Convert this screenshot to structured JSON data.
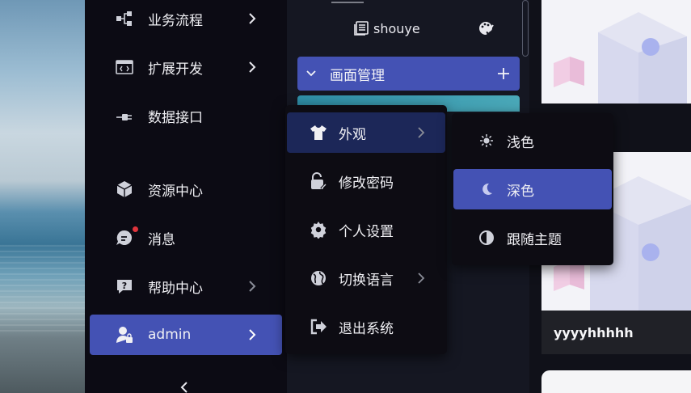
{
  "sidebar": {
    "items": [
      {
        "label": "业务流程",
        "icon": "flow-icon"
      },
      {
        "label": "扩展开发",
        "icon": "code-window-icon"
      },
      {
        "label": "数据接口",
        "icon": "plug-icon"
      },
      {
        "label": "资源中心",
        "icon": "cube-icon"
      },
      {
        "label": "消息",
        "icon": "message-icon"
      },
      {
        "label": "帮助中心",
        "icon": "help-icon"
      },
      {
        "label": "admin",
        "icon": "user-icon"
      }
    ]
  },
  "tree": {
    "page_item": "shouye",
    "group_title": "画面管理"
  },
  "user_menu": {
    "items": [
      {
        "label": "外观",
        "icon": "shirt-icon"
      },
      {
        "label": "修改密码",
        "icon": "unlock-icon"
      },
      {
        "label": "个人设置",
        "icon": "gear-icon"
      },
      {
        "label": "切换语言",
        "icon": "globe-icon"
      },
      {
        "label": "退出系统",
        "icon": "logout-icon"
      }
    ]
  },
  "appearance_menu": {
    "items": [
      {
        "label": "浅色",
        "icon": "sun-icon"
      },
      {
        "label": "深色",
        "icon": "moon-icon"
      },
      {
        "label": "跟随主题",
        "icon": "contrast-icon"
      }
    ],
    "selected": "深色"
  },
  "cards": {
    "caption": "yyyyhhhhh"
  },
  "colors": {
    "accent": "#4452b4",
    "hover": "#1c2758",
    "sidebar_bg": "#0c0b14",
    "notification_dot": "#e0343c"
  }
}
